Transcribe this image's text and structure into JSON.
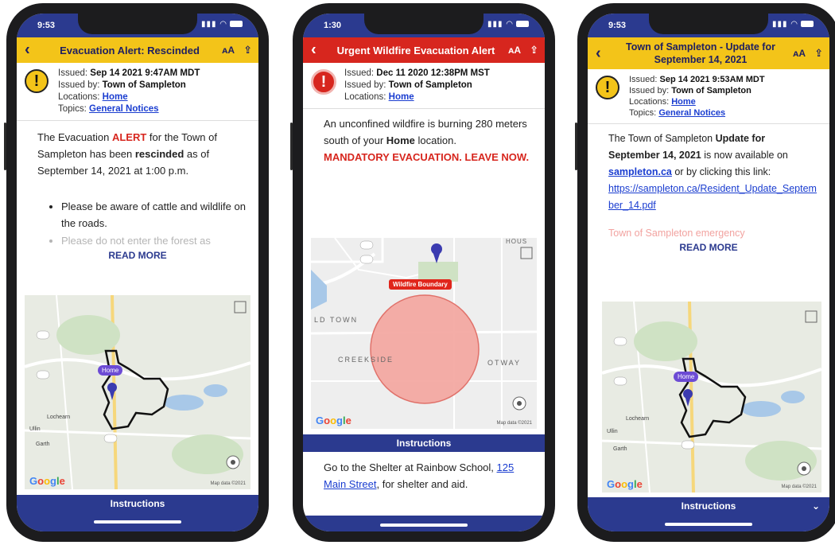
{
  "phones": [
    {
      "time": "9:53",
      "title": "Evacuation Alert: Rescinded",
      "issued_label": "Issued:",
      "issued": "Sep 14 2021 9:47AM MDT",
      "issued_by_label": "Issued by:",
      "issued_by": "Town of Sampleton",
      "locations_label": "Locations:",
      "location": "Home",
      "topics_label": "Topics:",
      "topic": "General Notices",
      "body_1": "The Evacuation ",
      "body_alert": "ALERT",
      "body_2": " for the Town of Sampleton has been ",
      "body_rescinded": "rescinded",
      "body_3": " as of September 14, 2021 at 1:00 p.m.",
      "bullet_1": "Please be aware of cattle and wildlife on the roads.",
      "bullet_2": "Please do not enter the forest as",
      "read_more": "READ MORE",
      "map_pin_label": "Home",
      "map_town": "Lochearn",
      "map_town2": "Garth",
      "map_town3": "Ullin",
      "instructions": "Instructions"
    },
    {
      "time": "1:30",
      "title": "Urgent Wildfire Evacuation Alert",
      "issued_label": "Issued:",
      "issued": "Dec 11 2020 12:38PM MST",
      "issued_by_label": "Issued by:",
      "issued_by": "Town of Sampleton",
      "locations_label": "Locations:",
      "location": "Home",
      "body_1": "An unconfined wildfire is burning 280 meters south of your ",
      "body_home": "Home",
      "body_2": " location.",
      "mandatory": "MANDATORY EVACUATION. LEAVE NOW.",
      "boundary_label": "Wildfire Boundary",
      "map_label_oldtown": "LD TOWN",
      "map_label_creekside": "CREEKSIDE",
      "map_label_otway": "OTWAY",
      "map_label_house": "HOUS",
      "instructions": "Instructions",
      "instr_text_1": "Go to the Shelter at Rainbow School, ",
      "instr_link": "125 Main Street",
      "instr_text_2": ", for shelter and aid."
    },
    {
      "time": "9:53",
      "title_line1": "Town of Sampleton - Update for",
      "title_line2": "September 14, 2021",
      "issued_label": "Issued:",
      "issued": "Sep 14 2021 9:53AM MDT",
      "issued_by_label": "Issued by:",
      "issued_by": "Town of Sampleton",
      "locations_label": "Locations:",
      "location": "Home",
      "topics_label": "Topics:",
      "topic": "General Notices",
      "body_1": "The Town of Sampleton ",
      "body_bold": "Update for September 14, 2021",
      "body_2": " is now available on ",
      "body_link": "sampleton.ca",
      "body_3": " or by clicking this link:",
      "body_url": "https://sampleton.ca/Resident_Update_September_14.pdf",
      "body_fade": "Town of Sampleton emergency",
      "read_more": "READ MORE",
      "map_pin_label": "Home",
      "map_town": "Lochearn",
      "map_town2": "Garth",
      "map_town3": "Ullin",
      "instructions": "Instructions"
    }
  ],
  "map_footer": "Map data ©2021",
  "google": "Google",
  "colors": {
    "navy": "#2b3a8f",
    "yellow": "#f3c419",
    "red": "#d7261e",
    "link": "#1a3dd0"
  }
}
